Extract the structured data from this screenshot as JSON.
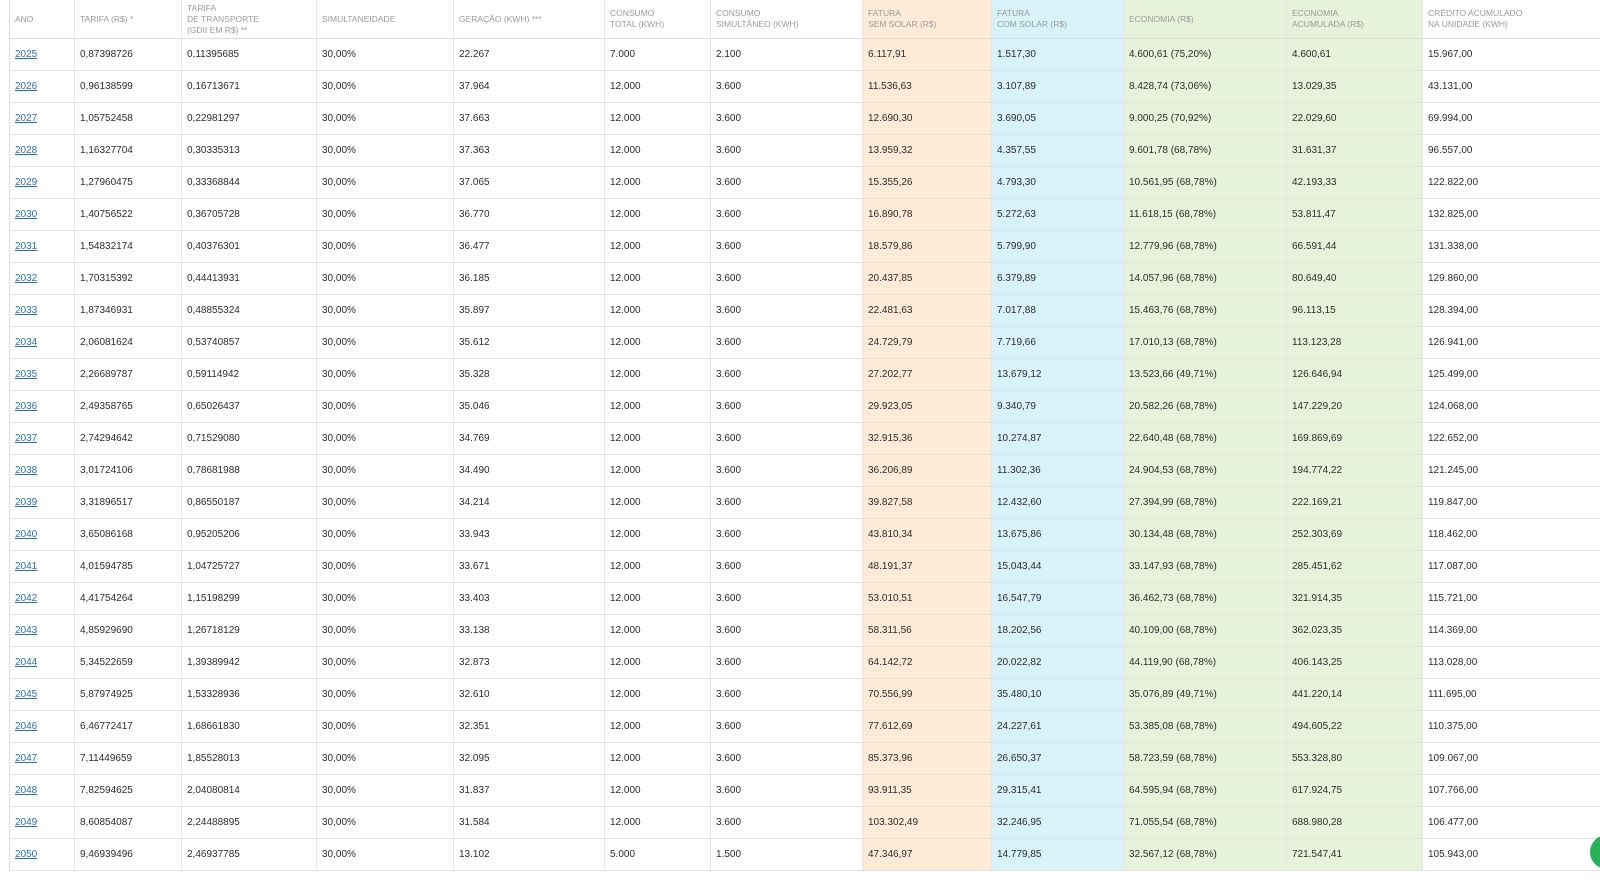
{
  "colors": {
    "fatura_sem_solar_bg": "#fdebd7",
    "fatura_com_solar_bg": "#d8f2f9",
    "economia_bg": "#e6f2d9",
    "link": "#2a6fa8",
    "chat_button": "#25b35a"
  },
  "chat_button": {
    "icon": "whatsapp-icon"
  },
  "table": {
    "headers": [
      [
        "ANO"
      ],
      [
        "TARIFA (R$) *"
      ],
      [
        "TARIFA",
        "DE TRANSPORTE",
        "(GDII EM R$) **"
      ],
      [
        "SIMULTANEIDADE"
      ],
      [
        "GERAÇÃO (KWH) ***"
      ],
      [
        "CONSUMO",
        "TOTAL (KWH)"
      ],
      [
        "CONSUMO",
        "SIMULTÂNEO (KWH)"
      ],
      [
        "FATURA",
        "SEM SOLAR (R$)"
      ],
      [
        "FATURA",
        "COM SOLAR (R$)"
      ],
      [
        "ECONOMIA (R$)"
      ],
      [
        "ECONOMIA",
        "ACUMULADA (R$)"
      ],
      [
        "CRÉDITO ACUMULADO",
        "NA UNIDADE (KWH)"
      ]
    ],
    "rows": [
      [
        "2025",
        "0,87398726",
        "0,11395685",
        "30,00%",
        "22.267",
        "7.000",
        "2.100",
        "6.117,91",
        "1.517,30",
        "4.600,61 (75,20%)",
        "4.600,61",
        "15.967,00"
      ],
      [
        "2026",
        "0,96138599",
        "0,16713671",
        "30,00%",
        "37.964",
        "12.000",
        "3.600",
        "11.536,63",
        "3.107,89",
        "8.428,74 (73,06%)",
        "13.029,35",
        "43.131,00"
      ],
      [
        "2027",
        "1,05752458",
        "0,22981297",
        "30,00%",
        "37.663",
        "12.000",
        "3.600",
        "12.690,30",
        "3.690,05",
        "9.000,25 (70,92%)",
        "22.029,60",
        "69.994,00"
      ],
      [
        "2028",
        "1,16327704",
        "0,30335313",
        "30,00%",
        "37.363",
        "12.000",
        "3.600",
        "13.959,32",
        "4.357,55",
        "9.601,78 (68,78%)",
        "31.631,37",
        "96.557,00"
      ],
      [
        "2029",
        "1,27960475",
        "0,33368844",
        "30,00%",
        "37.065",
        "12.000",
        "3.600",
        "15.355,26",
        "4.793,30",
        "10.561,95 (68,78%)",
        "42.193,33",
        "122.822,00"
      ],
      [
        "2030",
        "1,40756522",
        "0,36705728",
        "30,00%",
        "36.770",
        "12.000",
        "3.600",
        "16.890,78",
        "5.272,63",
        "11.618,15 (68,78%)",
        "53.811,47",
        "132.825,00"
      ],
      [
        "2031",
        "1,54832174",
        "0,40376301",
        "30,00%",
        "36.477",
        "12.000",
        "3.600",
        "18.579,86",
        "5.799,90",
        "12.779,96 (68,78%)",
        "66.591,44",
        "131.338,00"
      ],
      [
        "2032",
        "1,70315392",
        "0,44413931",
        "30,00%",
        "36.185",
        "12.000",
        "3.600",
        "20.437,85",
        "6.379,89",
        "14.057,96 (68,78%)",
        "80.649,40",
        "129.860,00"
      ],
      [
        "2033",
        "1,87346931",
        "0,48855324",
        "30,00%",
        "35.897",
        "12.000",
        "3.600",
        "22.481,63",
        "7.017,88",
        "15.463,76 (68,78%)",
        "96.113,15",
        "128.394,00"
      ],
      [
        "2034",
        "2,06081624",
        "0,53740857",
        "30,00%",
        "35.612",
        "12.000",
        "3.600",
        "24.729,79",
        "7.719,66",
        "17.010,13 (68,78%)",
        "113.123,28",
        "126.941,00"
      ],
      [
        "2035",
        "2,26689787",
        "0,59114942",
        "30,00%",
        "35.328",
        "12.000",
        "3.600",
        "27.202,77",
        "13.679,12",
        "13.523,66 (49,71%)",
        "126.646,94",
        "125.499,00"
      ],
      [
        "2036",
        "2,49358765",
        "0,65026437",
        "30,00%",
        "35.046",
        "12.000",
        "3.600",
        "29.923,05",
        "9.340,79",
        "20.582,26 (68,78%)",
        "147.229,20",
        "124.068,00"
      ],
      [
        "2037",
        "2,74294642",
        "0,71529080",
        "30,00%",
        "34.769",
        "12.000",
        "3.600",
        "32.915,36",
        "10.274,87",
        "22.640,48 (68,78%)",
        "169.869,69",
        "122.652,00"
      ],
      [
        "2038",
        "3,01724106",
        "0,78681988",
        "30,00%",
        "34.490",
        "12.000",
        "3.600",
        "36.206,89",
        "11.302,36",
        "24.904,53 (68,78%)",
        "194.774,22",
        "121.245,00"
      ],
      [
        "2039",
        "3,31896517",
        "0,86550187",
        "30,00%",
        "34.214",
        "12.000",
        "3.600",
        "39.827,58",
        "12.432,60",
        "27.394,99 (68,78%)",
        "222.169,21",
        "119.847,00"
      ],
      [
        "2040",
        "3,65086168",
        "0,95205206",
        "30,00%",
        "33.943",
        "12.000",
        "3.600",
        "43.810,34",
        "13.675,86",
        "30.134,48 (68,78%)",
        "252.303,69",
        "118.462,00"
      ],
      [
        "2041",
        "4,01594785",
        "1,04725727",
        "30,00%",
        "33.671",
        "12.000",
        "3.600",
        "48.191,37",
        "15.043,44",
        "33.147,93 (68,78%)",
        "285.451,62",
        "117.087,00"
      ],
      [
        "2042",
        "4,41754264",
        "1,15198299",
        "30,00%",
        "33.403",
        "12.000",
        "3.600",
        "53.010,51",
        "16.547,79",
        "36.462,73 (68,78%)",
        "321.914,35",
        "115.721,00"
      ],
      [
        "2043",
        "4,85929690",
        "1,26718129",
        "30,00%",
        "33.138",
        "12.000",
        "3.600",
        "58.311,56",
        "18.202,56",
        "40.109,00 (68,78%)",
        "362.023,35",
        "114.369,00"
      ],
      [
        "2044",
        "5,34522659",
        "1,39389942",
        "30,00%",
        "32.873",
        "12.000",
        "3.600",
        "64.142,72",
        "20.022,82",
        "44.119,90 (68,78%)",
        "406.143,25",
        "113.028,00"
      ],
      [
        "2045",
        "5,87974925",
        "1,53328936",
        "30,00%",
        "32.610",
        "12.000",
        "3.600",
        "70.556,99",
        "35.480,10",
        "35.076,89 (49,71%)",
        "441.220,14",
        "111.695,00"
      ],
      [
        "2046",
        "6,46772417",
        "1,68661830",
        "30,00%",
        "32.351",
        "12.000",
        "3.600",
        "77.612,69",
        "24.227,61",
        "53.385,08 (68,78%)",
        "494.605,22",
        "110.375,00"
      ],
      [
        "2047",
        "7,11449659",
        "1,85528013",
        "30,00%",
        "32.095",
        "12.000",
        "3.600",
        "85.373,96",
        "26.650,37",
        "58.723,59 (68,78%)",
        "553.328,80",
        "109.067,00"
      ],
      [
        "2048",
        "7,82594625",
        "2,04080814",
        "30,00%",
        "31.837",
        "12.000",
        "3.600",
        "93.911,35",
        "29.315,41",
        "64.595,94 (68,78%)",
        "617.924,75",
        "107.766,00"
      ],
      [
        "2049",
        "8,60854087",
        "2,24488895",
        "30,00%",
        "31.584",
        "12.000",
        "3.600",
        "103.302,49",
        "32.246,95",
        "71.055,54 (68,78%)",
        "688.980,28",
        "106.477,00"
      ],
      [
        "2050",
        "9,46939496",
        "2,46937785",
        "30,00%",
        "13.102",
        "5.000",
        "1.500",
        "47.346,97",
        "14.779,85",
        "32.567,12 (68,78%)",
        "721.547,41",
        "105.943,00"
      ]
    ]
  }
}
